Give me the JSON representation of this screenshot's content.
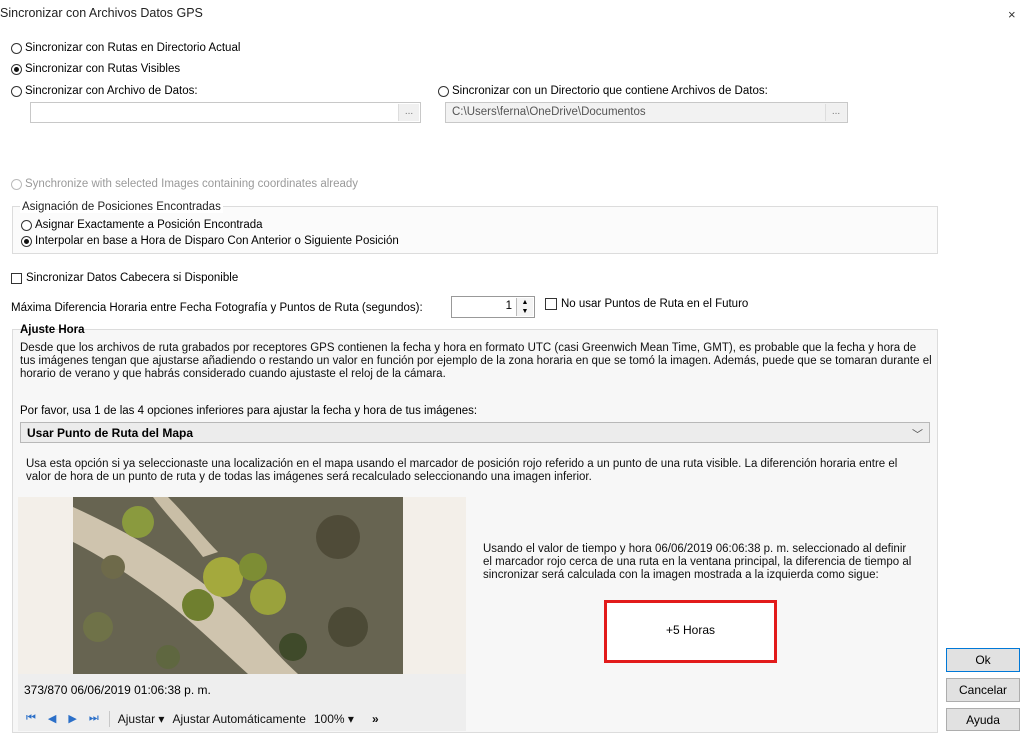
{
  "dialog": {
    "title": "Sincronizar con Archivos Datos GPS",
    "close_glyph": "×"
  },
  "sync_options": {
    "current_dir": "Sincronizar con Rutas en Directorio Actual",
    "visible_routes": "Sincronizar con Rutas Visibles",
    "data_file": "Sincronizar con Archivo de Datos:",
    "data_file_value": "",
    "data_dir": "Sincronizar con un Directorio que contiene Archivos de Datos:",
    "data_dir_value": "C:\\Users\\ferna\\OneDrive\\Documentos",
    "browse_label": "...",
    "selected_images": "Synchronize with selected Images containing coordinates already",
    "selected": "visible_routes"
  },
  "position_assignment": {
    "title": "Asignación de Posiciones Encontradas",
    "exact": "Asignar Exactamente a Posición Encontrada",
    "interpolate": "Interpolar en base a Hora de Disparo Con Anterior o Siguiente Posición",
    "selected": "interpolate"
  },
  "header_sync": {
    "label": "Sincronizar Datos Cabecera si Disponible",
    "checked": false
  },
  "max_diff": {
    "label": "Máxima Diferencia Horaria entre Fecha Fotografía y Puntos de Ruta (segundos):",
    "value": "1",
    "no_future_label": "No usar Puntos de Ruta en el Futuro",
    "no_future_checked": false
  },
  "ajuste": {
    "title": "Ajuste Hora",
    "description": "Desde que los archivos de ruta grabados por receptores GPS contienen la fecha y hora en formato UTC (casi  Greenwich Mean Time, GMT), es probable que la fecha y hora de tus imágenes tengan que ajustarse añadiendo o restando un valor en función por ejemplo de la zona horaria en que se tomó la imagen. Además, puede que se tomaran durante el horario de verano y que habrás considerado cuando ajustaste el reloj de la cámara.",
    "prompt": "Por favor, usa 1 de las 4 opciones inferiores para ajustar la fecha y hora de tus imágenes:",
    "dropdown_value": "Usar Punto de Ruta del Mapa",
    "option_description": "Usa esta opción si ya seleccionaste una localización en el mapa usando el marcador de posición rojo referido a un punto de una ruta visible. La diferención horaria entre el valor de hora de un punto de ruta y de todas las imágenes será recalculado seleccionando una imagen inferior.",
    "calc_text": "Usando el valor de tiempo y hora 06/06/2019 06:06:38 p. m. seleccionado al definir el marcador rojo cerca de una ruta en la ventana principal, la diferencia de tiempo al sincronizar será calculada con la imagen mostrada a la izquierda como sigue:",
    "result": "+5 Horas"
  },
  "preview": {
    "caption": "373/870 06/06/2019 01:06:38 p. m.",
    "toolbar": {
      "first_icon": "first-icon",
      "prev_icon": "prev-icon",
      "next_icon": "next-icon",
      "last_icon": "last-icon",
      "fit_label": "Ajustar ▾",
      "auto_fit_label": "Ajustar Automáticamente",
      "zoom_label": "100% ▾",
      "overflow": "»"
    }
  },
  "buttons": {
    "ok": "Ok",
    "cancel": "Cancelar",
    "help": "Ayuda"
  },
  "colors": {
    "highlight_border": "#e21b1b",
    "ok_border": "#0078d7"
  }
}
